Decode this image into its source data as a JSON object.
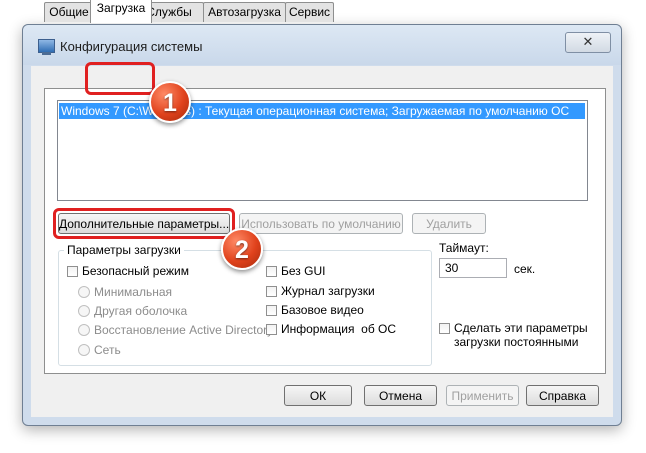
{
  "window": {
    "title": "Конфигурация системы",
    "close_glyph": "✕"
  },
  "tabs": [
    {
      "label": "Общие"
    },
    {
      "label": "Загрузка"
    },
    {
      "label": "Службы"
    },
    {
      "label": "Автозагрузка"
    },
    {
      "label": "Сервис"
    }
  ],
  "boot_list": {
    "selected_entry": "Windows 7 (C:\\Windows) : Текущая операционная система; Загружаемая по умолчанию ОС"
  },
  "list_buttons": {
    "advanced": "Дополнительные параметры...",
    "set_default": "Использовать по умолчанию",
    "delete": "Удалить"
  },
  "boot_options": {
    "legend": "Параметры загрузки",
    "safe_mode": "Безопасный режим",
    "minimal": "Минимальная",
    "alternate_shell": "Другая оболочка",
    "ad_repair": "Восстановление Active Directory",
    "network": "Сеть",
    "no_gui": "Без GUI",
    "boot_log": "Журнал загрузки",
    "base_video": "Базовое видео",
    "os_info": "Информация  об ОС"
  },
  "timeout": {
    "label": "Таймаут:",
    "value": "30",
    "unit": "сек."
  },
  "permanent": {
    "label_line1": "Сделать эти параметры",
    "label_line2": "загрузки постоянными"
  },
  "dialog_buttons": {
    "ok": "ОК",
    "cancel": "Отмена",
    "apply": "Применить",
    "help": "Справка"
  },
  "annotations": {
    "badge_1": "1",
    "badge_2": "2",
    "highlight_color": "#e02020",
    "badge_color": "#e0421c"
  }
}
